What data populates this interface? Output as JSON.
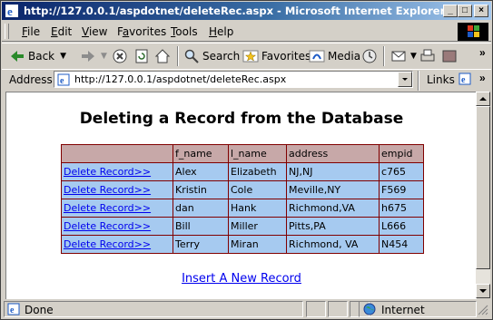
{
  "window": {
    "title": "http://127.0.0.1/aspdotnet/deleteRec.aspx - Microsoft Internet Explorer",
    "controls": [
      "_",
      "□",
      "×"
    ]
  },
  "menu": {
    "items": [
      "File",
      "Edit",
      "View",
      "Favorites",
      "Tools",
      "Help"
    ],
    "underline": [
      "F",
      "E",
      "V",
      "a",
      "T",
      "H"
    ]
  },
  "toolbar": {
    "back": "Back",
    "search": "Search",
    "favorites": "Favorites",
    "media": "Media"
  },
  "address": {
    "label": "Address",
    "url": "http://127.0.0.1/aspdotnet/deleteRec.aspx",
    "links": "Links"
  },
  "page": {
    "heading": "Deleting a Record from the Database",
    "columns": [
      "",
      "f_name",
      "l_name",
      "address",
      "empid"
    ],
    "rows": [
      {
        "action": "Delete Record>>",
        "f_name": "Alex",
        "l_name": "Elizabeth",
        "address": "NJ,NJ",
        "empid": "c765"
      },
      {
        "action": "Delete Record>>",
        "f_name": "Kristin",
        "l_name": "Cole",
        "address": "Meville,NY",
        "empid": "F569"
      },
      {
        "action": "Delete Record>>",
        "f_name": "dan",
        "l_name": "Hank",
        "address": "Richmond,VA",
        "empid": "h675"
      },
      {
        "action": "Delete Record>>",
        "f_name": "Bill",
        "l_name": "Miller",
        "address": "Pitts,PA",
        "empid": "L666"
      },
      {
        "action": "Delete Record>>",
        "f_name": "Terry",
        "l_name": "Miran",
        "address": "Richmond, VA",
        "empid": "N454"
      }
    ],
    "insert_link": "Insert A New Record"
  },
  "status": {
    "text": "Done",
    "zone": "Internet"
  },
  "colors": {
    "title_start": "#0a246a",
    "title_end": "#a6caf0",
    "table_bg": "#a6caf0",
    "table_header_bg": "#c7a8a8",
    "table_border": "#800000",
    "link": "#0000ee"
  }
}
